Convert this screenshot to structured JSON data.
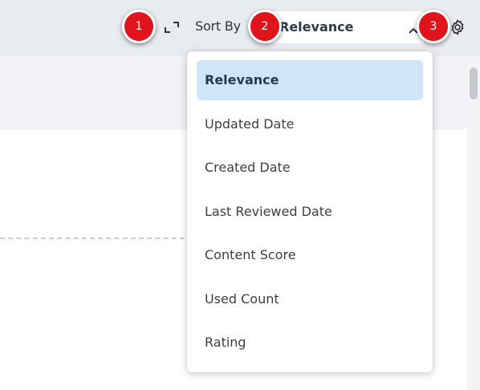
{
  "toolbar": {
    "expand_icon": "expand-corners-icon",
    "sort_label": "Sort By",
    "sort_value": "Relevance",
    "chevron_icon": "chevron-up-icon",
    "settings_icon": "gear-icon"
  },
  "dropdown": {
    "items": [
      {
        "label": "Relevance",
        "selected": true
      },
      {
        "label": "Updated Date",
        "selected": false
      },
      {
        "label": "Created Date",
        "selected": false
      },
      {
        "label": "Last Reviewed Date",
        "selected": false
      },
      {
        "label": "Content Score",
        "selected": false
      },
      {
        "label": "Used Count",
        "selected": false
      },
      {
        "label": "Rating",
        "selected": false
      }
    ]
  },
  "callouts": [
    "1",
    "2",
    "3"
  ],
  "colors": {
    "callout_red": "#e0141b",
    "selected_bg": "#cfe5f8",
    "topbar_bg": "#e8ebef"
  }
}
